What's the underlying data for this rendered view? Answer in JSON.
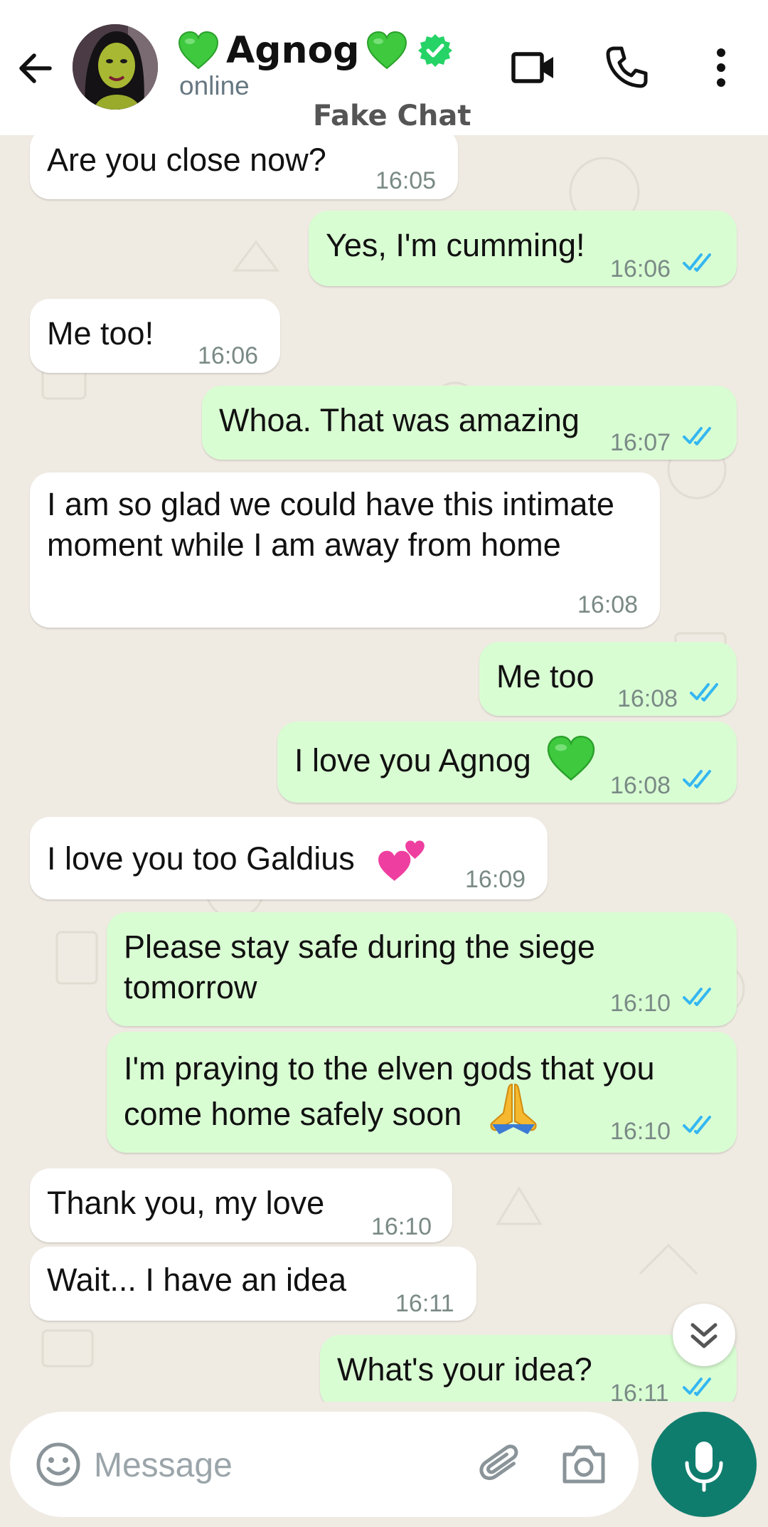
{
  "header": {
    "contact_name": "Agnog",
    "status": "online",
    "watermark": "Fake Chat"
  },
  "colors": {
    "accent": "#0f7d6e",
    "outgoing_bubble": "#d9fdd3",
    "incoming_bubble": "#ffffff",
    "chat_background": "#efeae2",
    "read_ticks": "#34b7f1",
    "verified_badge": "#25d366"
  },
  "messages": [
    {
      "direction": "in",
      "text": "Are you close now?",
      "time": "16:05"
    },
    {
      "direction": "out",
      "text": "Yes, I'm cumming!",
      "time": "16:06"
    },
    {
      "direction": "in",
      "text": "Me too!",
      "time": "16:06"
    },
    {
      "direction": "out",
      "text": "Whoa. That was amazing",
      "time": "16:07"
    },
    {
      "direction": "in",
      "text": "I am so glad we could have this intimate moment while I am away from home",
      "time": "16:08"
    },
    {
      "direction": "out",
      "text": "Me too",
      "time": "16:08"
    },
    {
      "direction": "out",
      "text": "I love you Agnog",
      "time": "16:08",
      "emoji": "green-heart"
    },
    {
      "direction": "in",
      "text": "I love you too Galdius",
      "time": "16:09",
      "emoji": "two-hearts"
    },
    {
      "direction": "out",
      "text": "Please stay safe during the siege tomorrow",
      "time": "16:10"
    },
    {
      "direction": "out",
      "text": "I'm praying to the elven gods that you come home safely soon",
      "time": "16:10",
      "emoji": "folded-hands"
    },
    {
      "direction": "in",
      "text": "Thank you, my love",
      "time": "16:10"
    },
    {
      "direction": "in",
      "text": "Wait... I have an idea",
      "time": "16:11"
    },
    {
      "direction": "out",
      "text": "What's your idea?",
      "time": "16:11"
    }
  ],
  "input": {
    "placeholder": "Message"
  },
  "icons": {
    "back": "arrow-left-icon",
    "video": "video-camera-icon",
    "call": "phone-icon",
    "menu": "more-vertical-icon",
    "emoji": "smiley-icon",
    "attach": "paperclip-icon",
    "camera": "camera-icon",
    "mic": "microphone-icon",
    "scroll": "double-chevron-down-icon"
  }
}
